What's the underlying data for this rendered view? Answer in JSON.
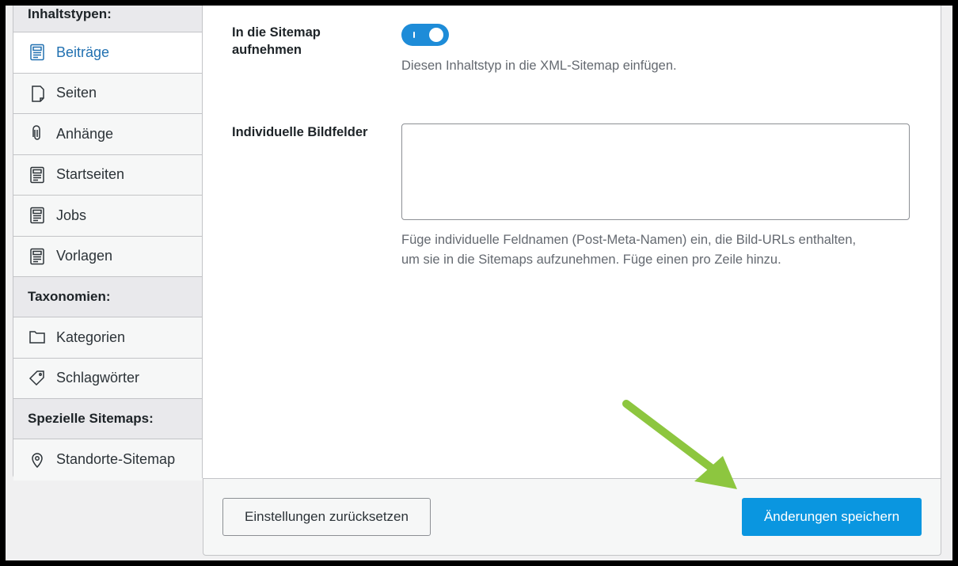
{
  "sidebar": {
    "content_types_heading": "Inhaltstypen:",
    "content_types": [
      {
        "label": "Beiträge",
        "icon": "post-icon",
        "active": true
      },
      {
        "label": "Seiten",
        "icon": "page-icon"
      },
      {
        "label": "Anhänge",
        "icon": "paperclip-icon"
      },
      {
        "label": "Startseiten",
        "icon": "post-icon"
      },
      {
        "label": "Jobs",
        "icon": "post-icon"
      },
      {
        "label": "Vorlagen",
        "icon": "post-icon"
      }
    ],
    "taxonomies_heading": "Taxonomien:",
    "taxonomies": [
      {
        "label": "Kategorien",
        "icon": "folder-icon"
      },
      {
        "label": "Schlagwörter",
        "icon": "tag-icon"
      }
    ],
    "special_heading": "Spezielle Sitemaps:",
    "special": [
      {
        "label": "Standorte-Sitemap",
        "icon": "location-pin-icon"
      }
    ]
  },
  "main": {
    "sitemap_label_line1": "In die Sitemap",
    "sitemap_label_line2": "aufnehmen",
    "sitemap_toggle_on": true,
    "sitemap_desc": "Diesen Inhaltstyp in die XML-Sitemap einfügen.",
    "image_fields_label": "Individuelle Bildfelder",
    "image_fields_value": "",
    "image_fields_desc_line1": "Füge individuelle Feldnamen (Post-Meta-Namen) ein, die Bild-URLs enthalten,",
    "image_fields_desc_line2": "um sie in die Sitemaps aufzunehmen. Füge einen pro Zeile hinzu."
  },
  "footer": {
    "reset_label": "Einstellungen zurücksetzen",
    "save_label": "Änderungen speichern"
  },
  "colors": {
    "accent": "#0a96e0",
    "active_link": "#2271b1",
    "annotation_arrow": "#8dc63f"
  }
}
